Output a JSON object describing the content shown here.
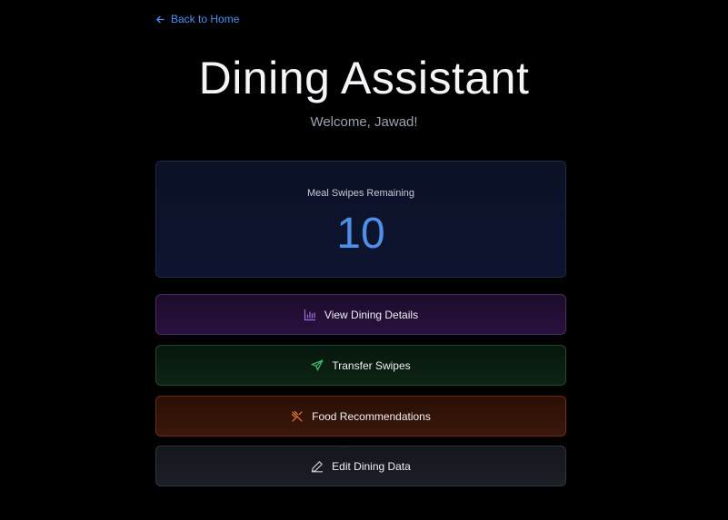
{
  "nav": {
    "back_label": "Back to Home"
  },
  "header": {
    "title": "Dining Assistant",
    "welcome": "Welcome, Jawad!"
  },
  "swipes": {
    "label": "Meal Swipes Remaining",
    "count": "10"
  },
  "actions": [
    {
      "label": "View Dining Details",
      "icon": "bar-chart-icon",
      "color": "#a26bd8"
    },
    {
      "label": "Transfer Swipes",
      "icon": "send-icon",
      "color": "#3fbf6a"
    },
    {
      "label": "Food Recommendations",
      "icon": "utensils-crossed-icon",
      "color": "#f07a3a"
    },
    {
      "label": "Edit Dining Data",
      "icon": "pencil-icon",
      "color": "#c9ccd3"
    }
  ],
  "colors": {
    "accent": "#4b8ff0",
    "background": "#000000"
  }
}
